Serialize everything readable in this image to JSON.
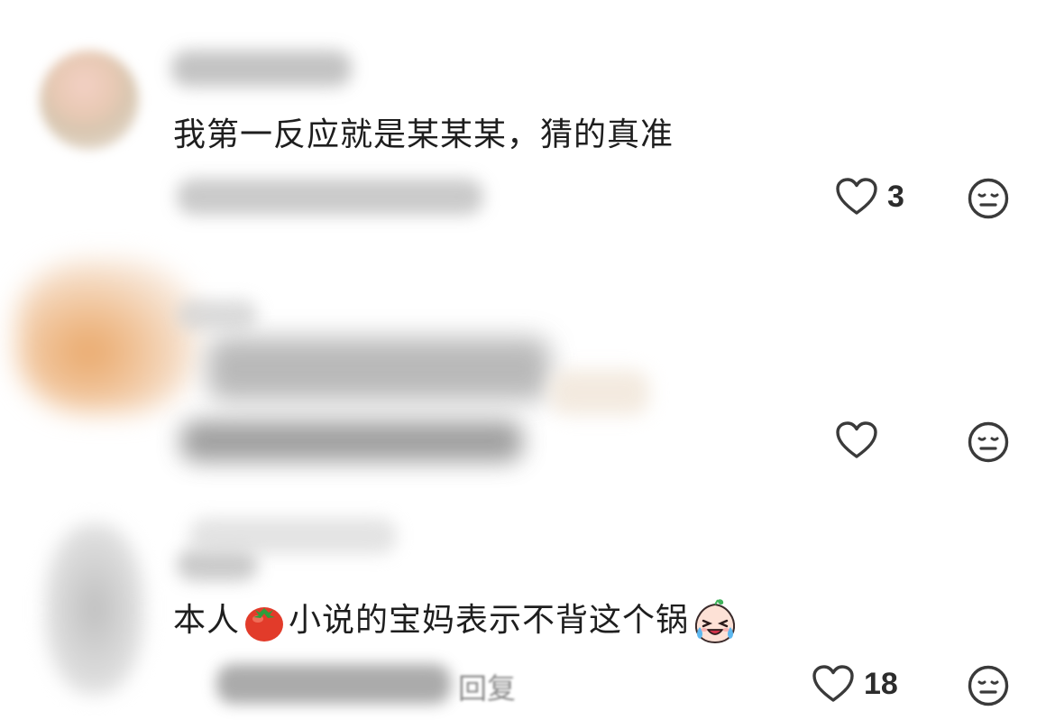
{
  "comments": [
    {
      "text": "我第一反应就是某某某，猜的真准",
      "likes": "3"
    },
    {
      "text": "",
      "likes": ""
    },
    {
      "text_before": "本人",
      "emoji_tomato": "tomato-icon",
      "text_middle": "小说的宝妈表示不背这个锅",
      "emoji_crying": "crying-face-icon",
      "likes": "18",
      "reply_label": "回复"
    }
  ],
  "colors": {
    "text": "#1e1e1e",
    "icon": "#3a3a3a",
    "blur_gray": "#9a9a9a"
  }
}
